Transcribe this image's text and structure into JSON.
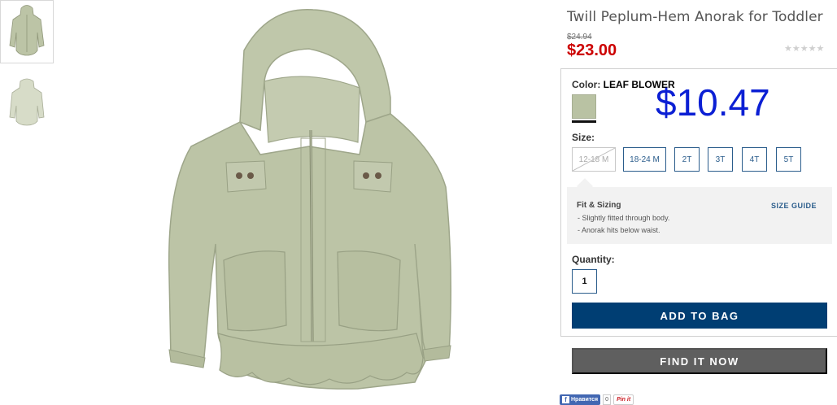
{
  "product": {
    "title": "Twill Peplum-Hem Anorak for Toddler",
    "was_price": "$24.94",
    "now_price": "$23.00",
    "rating_stars": "★★★★★",
    "promo_price": "$10.47"
  },
  "color": {
    "label": "Color:",
    "value": "LEAF BLOWER",
    "swatch_hex": "#b9c2a3"
  },
  "size": {
    "label": "Size:",
    "options": [
      "12-18 M",
      "18-24 M",
      "2T",
      "3T",
      "4T",
      "5T"
    ],
    "unavailable": [
      "12-18 M"
    ]
  },
  "fit": {
    "title": "Fit & Sizing",
    "lines": [
      "- Slightly fitted through body.",
      "- Anorak hits below waist."
    ],
    "guide_link": "SIZE GUIDE"
  },
  "quantity": {
    "label": "Quantity:",
    "value": "1"
  },
  "buttons": {
    "add_to_bag": "ADD TO BAG",
    "find_it_now": "FIND IT NOW"
  },
  "social": {
    "facebook_label": "Нравится",
    "facebook_count": "0",
    "pinterest_label": "Pin it"
  },
  "colors": {
    "price_red": "#cc0000",
    "link_blue": "#2b5d8c",
    "add_bag_bg": "#003e73",
    "find_now_bg": "#5f5f5f",
    "promo_blue": "#0b1fd4",
    "jacket_green": "#bcc4a6"
  }
}
